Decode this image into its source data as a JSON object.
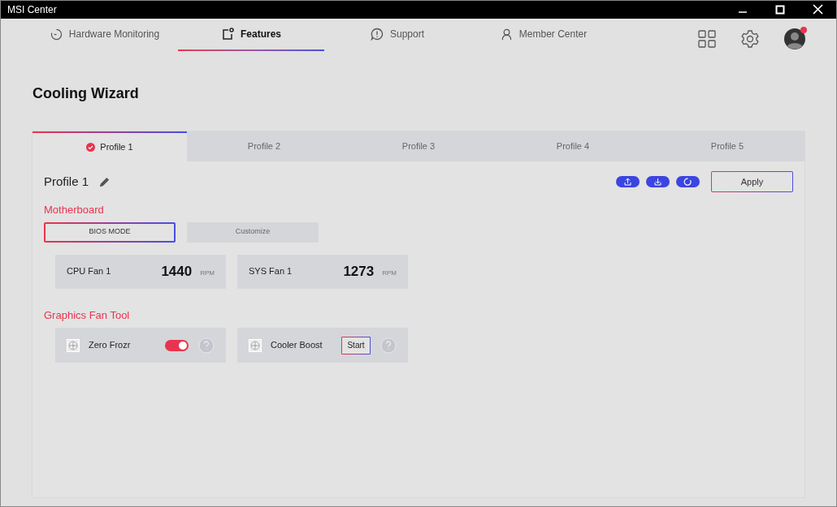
{
  "window": {
    "title": "MSI Center"
  },
  "nav_tabs": [
    {
      "label": "Hardware Monitoring",
      "selected": false
    },
    {
      "label": "Features",
      "selected": true
    },
    {
      "label": "Support",
      "selected": false
    },
    {
      "label": "Member Center",
      "selected": false
    }
  ],
  "page_title": "Cooling Wizard",
  "profile_tabs": [
    {
      "label": "Profile 1",
      "selected": true
    },
    {
      "label": "Profile 2",
      "selected": false
    },
    {
      "label": "Profile 3",
      "selected": false
    },
    {
      "label": "Profile 4",
      "selected": false
    },
    {
      "label": "Profile 5",
      "selected": false
    }
  ],
  "profile_name": "Profile 1",
  "apply_button": "Apply",
  "motherboard": {
    "heading": "Motherboard",
    "modes": [
      {
        "label": "BIOS MODE",
        "selected": true
      },
      {
        "label": "Customize",
        "selected": false
      }
    ],
    "fans": [
      {
        "name": "CPU Fan 1",
        "speed": "1440",
        "unit": "RPM"
      },
      {
        "name": "SYS Fan 1",
        "speed": "1273",
        "unit": "RPM"
      }
    ]
  },
  "graphics_fan_tool": {
    "heading": "Graphics Fan Tool",
    "tools": [
      {
        "kind": "toggle",
        "name": "Zero Frozr",
        "on": true
      },
      {
        "kind": "button",
        "name": "Cooler Boost",
        "button": "Start"
      }
    ]
  }
}
